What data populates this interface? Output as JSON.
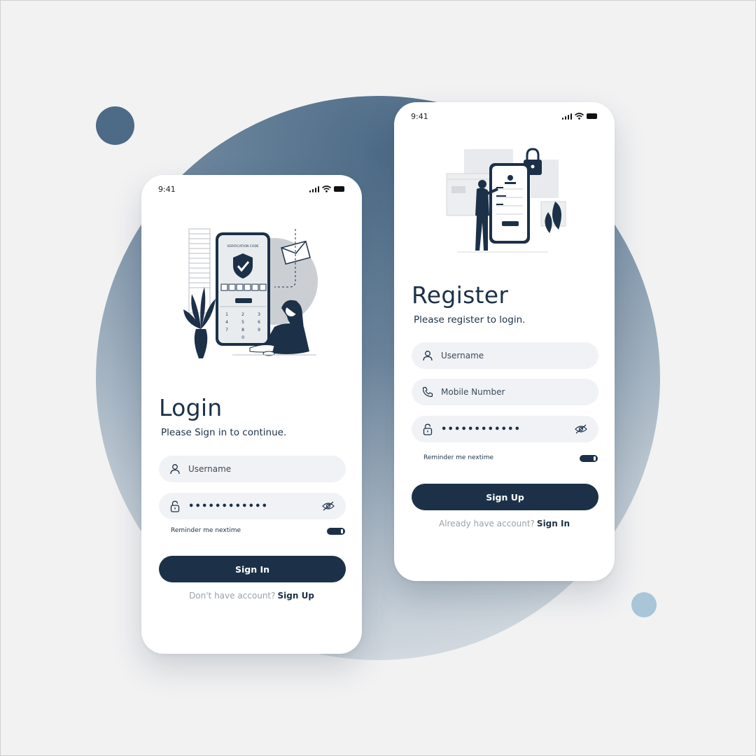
{
  "status_bar": {
    "time": "9:41"
  },
  "login": {
    "verification_text": "VERIFICATION CODE",
    "keypad": [
      "1",
      "2",
      "3",
      "4",
      "5",
      "6",
      "7",
      "8",
      "9",
      "0"
    ],
    "title": "Login",
    "subtitle": "Please Sign in to continue.",
    "username_placeholder": "Username",
    "password_masked": "••••••••••••",
    "remember_label": "Reminder me nextime",
    "remember_on": true,
    "button_label": "Sign In",
    "footer_text": "Don't have account?",
    "footer_link": "Sign Up"
  },
  "register": {
    "title": "Register",
    "subtitle": "Please register to login.",
    "username_placeholder": "Username",
    "mobile_placeholder": "Mobile Number",
    "password_masked": "••••••••••••",
    "remember_label": "Reminder me nextime",
    "remember_on": true,
    "button_label": "Sign Up",
    "footer_text": "Already have account?",
    "footer_link": "Sign In"
  },
  "icons": {
    "user": "user-icon",
    "phone": "phone-icon",
    "lock": "lock-icon",
    "eye_off": "eye-off-icon",
    "signal": "signal-icon",
    "wifi": "wifi-icon",
    "battery": "battery-icon"
  },
  "colors": {
    "primary": "#1c3148",
    "accent_circle": "#4d6a86",
    "light_dot": "#a9c5d8",
    "field_bg": "#f1f2f5",
    "background": "#f2f2f3"
  }
}
